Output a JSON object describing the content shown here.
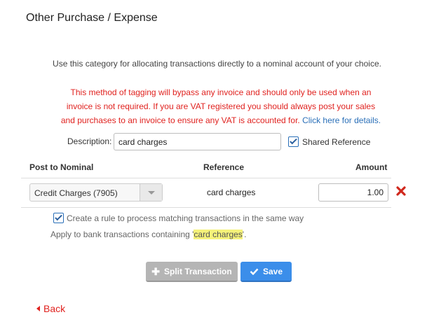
{
  "page": {
    "title": "Other Purchase / Expense"
  },
  "intro": "Use this category for allocating transactions directly to a nominal account of your choice.",
  "warning": {
    "line1": "This method of tagging will bypass any invoice and should only be used when an",
    "line2": "invoice is not required. If you are VAT registered you should always post your sales",
    "line3": "and purchases to an invoice to ensure any VAT is accounted for.",
    "link": "Click here for details."
  },
  "description": {
    "label": "Description:",
    "value": "card charges",
    "shared_label": "Shared Reference",
    "shared_checked": true
  },
  "table": {
    "headers": {
      "nominal": "Post to Nominal",
      "reference": "Reference",
      "amount": "Amount"
    },
    "row": {
      "nominal": "Credit Charges (7905)",
      "reference": "card charges",
      "amount": "1.00"
    }
  },
  "rule": {
    "label": "Create a rule to process matching transactions in the same way",
    "checked": true,
    "apply_prefix": "Apply to bank transactions containing '",
    "apply_term": "card charges",
    "apply_suffix": "'."
  },
  "buttons": {
    "split": "Split Transaction",
    "save": "Save"
  },
  "back": "Back",
  "colors": {
    "warning": "#e0221f",
    "link": "#2a6fb8",
    "save": "#3b8eea",
    "split": "#b5b5b5",
    "highlight": "#f5f27a"
  }
}
